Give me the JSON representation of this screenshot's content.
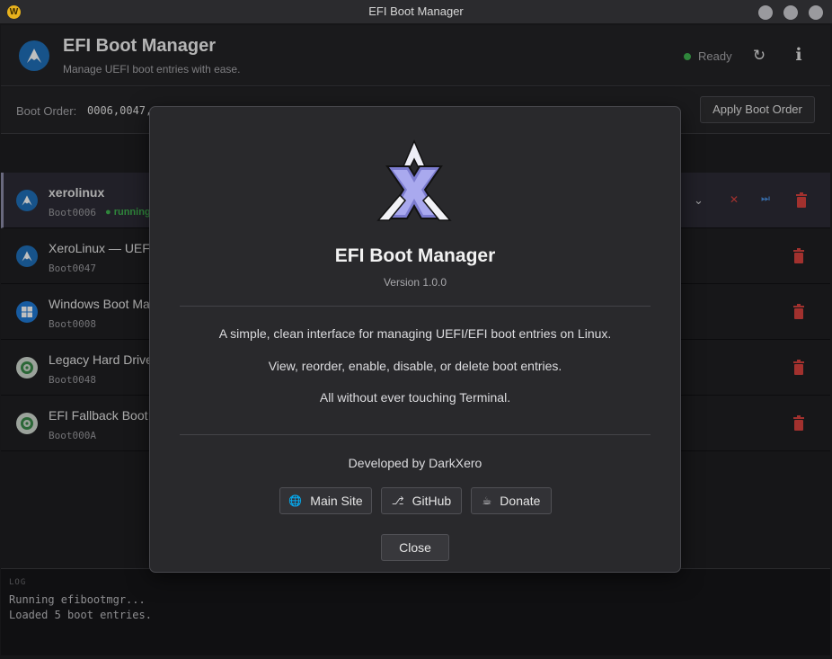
{
  "window": {
    "title": "EFI Boot Manager",
    "app_icon_letter": "W"
  },
  "header": {
    "title": "EFI Boot Manager",
    "subtitle": "Manage UEFI boot entries with ease.",
    "status": "Ready",
    "status_color": "#3fb34f",
    "refresh_icon": "↻",
    "info_icon": "i"
  },
  "order_bar": {
    "label": "Boot Order:",
    "value": "0006,0047,",
    "apply_label": "Apply Boot Order"
  },
  "entries": [
    {
      "name": "xerolinux",
      "id": "Boot0006",
      "running": "● running",
      "icon": "arch-icon",
      "active": true
    },
    {
      "name": "XeroLinux — UEF",
      "id": "Boot0047",
      "icon": "arch-icon"
    },
    {
      "name": "Windows Boot Ma",
      "id": "Boot0008",
      "icon": "windows-icon"
    },
    {
      "name": "Legacy Hard Drive",
      "id": "Boot0048",
      "icon": "disk-icon"
    },
    {
      "name": "EFI Fallback Boot",
      "id": "Boot000A",
      "icon": "disk-icon"
    }
  ],
  "log": {
    "title": "LOG",
    "lines": [
      "Running efibootmgr...",
      "Loaded 5 boot entries."
    ]
  },
  "about": {
    "title": "EFI Boot Manager",
    "version": "Version 1.0.0",
    "lines": [
      "A simple, clean interface for managing UEFI/EFI boot entries on Linux.",
      "View, reorder, enable, disable, or delete boot entries.",
      "All without ever touching Terminal."
    ],
    "developed_by": "Developed by  DarkXero",
    "buttons": {
      "main_site": "Main Site",
      "github": "GitHub",
      "donate": "Donate"
    },
    "close": "Close"
  },
  "colors": {
    "accent_blue": "#1f6fb8",
    "danger": "#d9423e",
    "running_green": "#3fb34f"
  }
}
